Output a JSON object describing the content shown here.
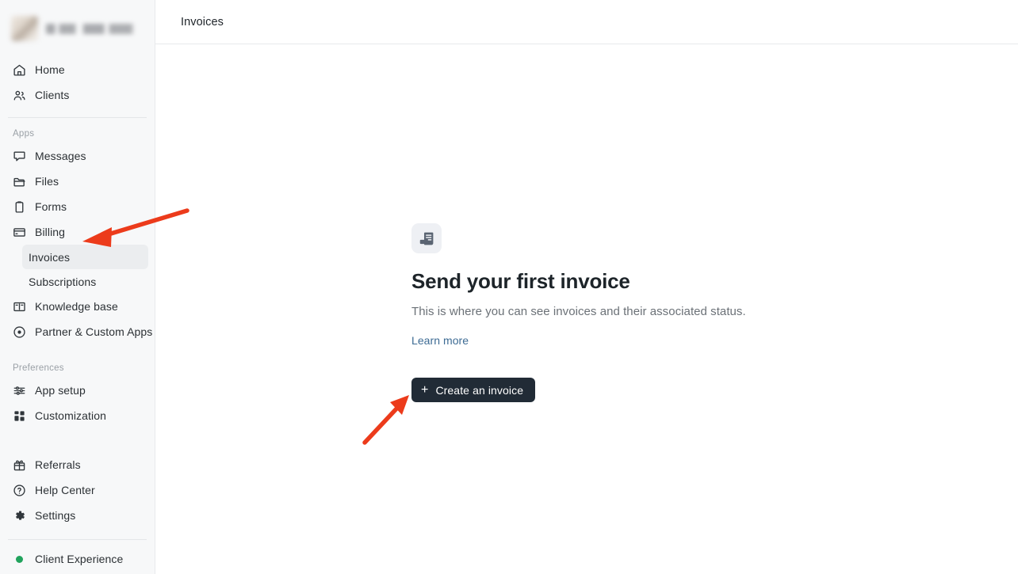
{
  "workspace": {
    "name_redacted": "",
    "logo_icon": "workspace-logo-redacted"
  },
  "sidebar": {
    "primary": [
      {
        "label": "Home",
        "icon": "home-icon"
      },
      {
        "label": "Clients",
        "icon": "clients-icon"
      }
    ],
    "apps_section_title": "Apps",
    "apps": [
      {
        "label": "Messages",
        "icon": "message-icon"
      },
      {
        "label": "Files",
        "icon": "folder-icon"
      },
      {
        "label": "Forms",
        "icon": "clipboard-icon"
      },
      {
        "label": "Billing",
        "icon": "credit-card-icon"
      },
      {
        "label": "Knowledge base",
        "icon": "book-icon"
      },
      {
        "label": "Partner & Custom Apps",
        "icon": "target-icon"
      }
    ],
    "billing_children": [
      {
        "label": "Invoices",
        "active": true
      },
      {
        "label": "Subscriptions",
        "active": false
      }
    ],
    "preferences_section_title": "Preferences",
    "preferences": [
      {
        "label": "App setup",
        "icon": "sliders-icon"
      },
      {
        "label": "Customization",
        "icon": "grid-icon"
      }
    ],
    "utility": [
      {
        "label": "Referrals",
        "icon": "gift-icon"
      },
      {
        "label": "Help Center",
        "icon": "help-circle-icon"
      },
      {
        "label": "Settings",
        "icon": "gear-icon"
      }
    ],
    "footer": {
      "label": "Client Experience",
      "icon": "status-dot-icon",
      "status_color": "#21a35d"
    }
  },
  "header": {
    "title": "Invoices"
  },
  "empty_state": {
    "icon": "invoice-icon",
    "title": "Send your first invoice",
    "description": "This is where you can see invoices and their associated status.",
    "link_label": "Learn more",
    "button_label": "Create an invoice",
    "button_icon": "plus-icon"
  },
  "annotations": {
    "arrow_color": "#ec3b1b",
    "arrows": [
      {
        "name": "arrow-to-invoices",
        "points_to": "Invoices"
      },
      {
        "name": "arrow-to-create-button",
        "points_to": "Create an invoice"
      }
    ]
  }
}
